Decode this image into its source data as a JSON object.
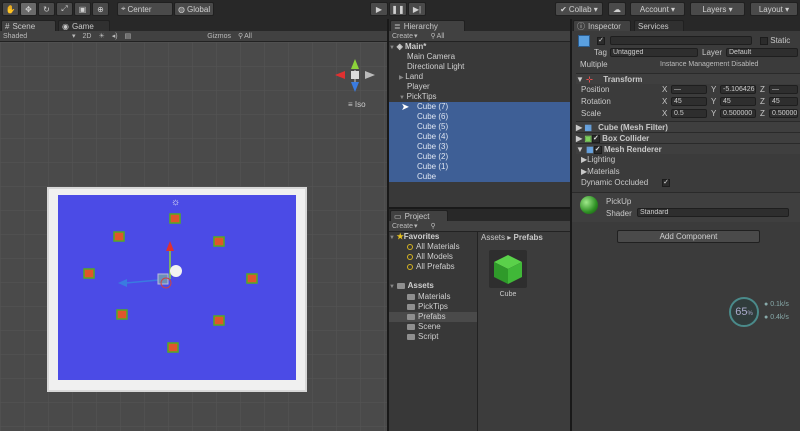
{
  "toolbar": {
    "pivot": "Center",
    "space": "Global",
    "collab": "Collab",
    "account": "Account",
    "layers": "Layers",
    "layout": "Layout"
  },
  "scene": {
    "tab_scene": "Scene",
    "tab_game": "Game",
    "shading": "Shaded",
    "mode_2d": "2D",
    "gizmos": "Gizmos",
    "search": "All",
    "gizmo_label": "Iso"
  },
  "hierarchy": {
    "tab": "Hierarchy",
    "create": "Create",
    "search": "All",
    "root": "Main*",
    "items": [
      {
        "label": "Main Camera"
      },
      {
        "label": "Directional Light"
      },
      {
        "label": "Land"
      },
      {
        "label": "Player"
      },
      {
        "label": "PickTips"
      },
      {
        "label": "Cube (7)"
      },
      {
        "label": "Cube (6)"
      },
      {
        "label": "Cube (5)"
      },
      {
        "label": "Cube (4)"
      },
      {
        "label": "Cube (3)"
      },
      {
        "label": "Cube (2)"
      },
      {
        "label": "Cube (1)"
      },
      {
        "label": "Cube"
      }
    ]
  },
  "project": {
    "tab": "Project",
    "create": "Create",
    "favorites": "Favorites",
    "fav_items": [
      {
        "label": "All Materials"
      },
      {
        "label": "All Models"
      },
      {
        "label": "All Prefabs"
      }
    ],
    "assets": "Assets",
    "asset_folders": [
      {
        "label": "Materials"
      },
      {
        "label": "PickTips"
      },
      {
        "label": "Prefabs"
      },
      {
        "label": "Scene"
      },
      {
        "label": "Script"
      }
    ],
    "breadcrumb_root": "Assets",
    "breadcrumb_sep": "▸",
    "breadcrumb_current": "Prefabs",
    "asset_name": "Cube"
  },
  "inspector": {
    "tab": "Inspector",
    "tab_services": "Services",
    "static_label": "Static",
    "tag_label": "Tag",
    "tag_value": "Untagged",
    "layer_label": "Layer",
    "layer_value": "Default",
    "multiple": "Multiple",
    "instance_mgmt": "Instance Management Disabled",
    "transform": {
      "title": "Transform",
      "position_label": "Position",
      "rotation_label": "Rotation",
      "scale_label": "Scale",
      "position": {
        "x": "—",
        "y": "-5.106426",
        "z": "—"
      },
      "rotation": {
        "x": "45",
        "y": "45",
        "z": "45"
      },
      "scale": {
        "x": "0.5",
        "y": "0.500000",
        "z": "0.500000"
      }
    },
    "mesh_filter": "Cube (Mesh Filter)",
    "box_collider": "Box Collider",
    "mesh_renderer": "Mesh Renderer",
    "lighting": "Lighting",
    "materials": "Materials",
    "dynamic_occluded": "Dynamic Occluded",
    "material_name": "PickUp",
    "shader_label": "Shader",
    "shader_value": "Standard",
    "add_component": "Add Component",
    "stats_percent": "65",
    "stats_unit": "%",
    "stat1": "0.1k/s",
    "stat2": "0.4k/s"
  },
  "colors": {
    "selection": "#3e5f96",
    "plane": "#4747e6",
    "pickup": "#e0562a"
  }
}
